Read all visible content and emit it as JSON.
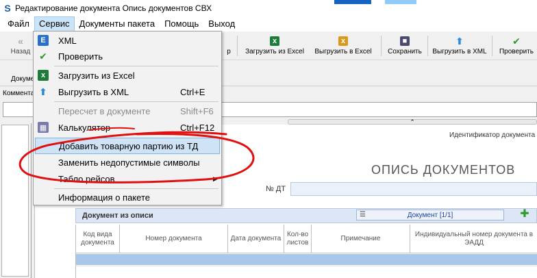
{
  "window": {
    "title": "Редактирование документа Опись документов СВХ"
  },
  "menubar": {
    "items": [
      "Файл",
      "Сервис",
      "Документы пакета",
      "Помощь",
      "Выход"
    ]
  },
  "toolbar": {
    "back_label": "Назад",
    "partial_label": "р",
    "load_excel_label": "Загрузить из Excel",
    "export_excel_label": "Выгрузить в Excel",
    "save_label": "Сохранить",
    "export_xml_label": "Выгрузить в XML",
    "check_label": "Проверить"
  },
  "row2": {
    "label": "Докуме"
  },
  "comment": {
    "label": "Коммента"
  },
  "document": {
    "id_label": "Идентификатор документа",
    "heading": "ОПИСЬ ДОКУМЕНТОВ",
    "dt_label": "№ ДТ",
    "section_title": "Документ из описи",
    "nav_label": "Документ [1/1]",
    "columns": [
      "Код вида документа",
      "Номер документа",
      "Дата документа",
      "Кол-во листов",
      "Примечание",
      "Индивидуальный номер документа в ЭАДД"
    ]
  },
  "dropdown": {
    "items": [
      {
        "label": "XML",
        "shortcut": "",
        "disabled": false,
        "icon": "xml-icon"
      },
      {
        "label": "Проверить",
        "shortcut": "",
        "disabled": false,
        "icon": "check-icon"
      },
      {
        "label": "Загрузить из Excel",
        "shortcut": "",
        "disabled": false,
        "icon": "excel-icon"
      },
      {
        "label": "Выгрузить в XML",
        "shortcut": "Ctrl+E",
        "disabled": false,
        "icon": "upload-arrow-icon"
      },
      {
        "label": "Пересчет в документе",
        "shortcut": "Shift+F6",
        "disabled": true,
        "icon": ""
      },
      {
        "label": "Калькулятор",
        "shortcut": "Ctrl+F12",
        "disabled": false,
        "icon": "calculator-icon"
      },
      {
        "label": "Добавить товарную партию из ТД",
        "shortcut": "",
        "disabled": false,
        "icon": ""
      },
      {
        "label": "Заменить недопустимые символы",
        "shortcut": "",
        "disabled": false,
        "icon": ""
      },
      {
        "label": "Табло рейсов",
        "shortcut": "",
        "disabled": false,
        "icon": ""
      },
      {
        "label": "Информация о пакете",
        "shortcut": "",
        "disabled": false,
        "icon": ""
      }
    ]
  },
  "colors": {
    "menu_highlight": "#cfe3f7",
    "annotation_red": "#e01010",
    "selected_row": "#a7c7eb"
  }
}
